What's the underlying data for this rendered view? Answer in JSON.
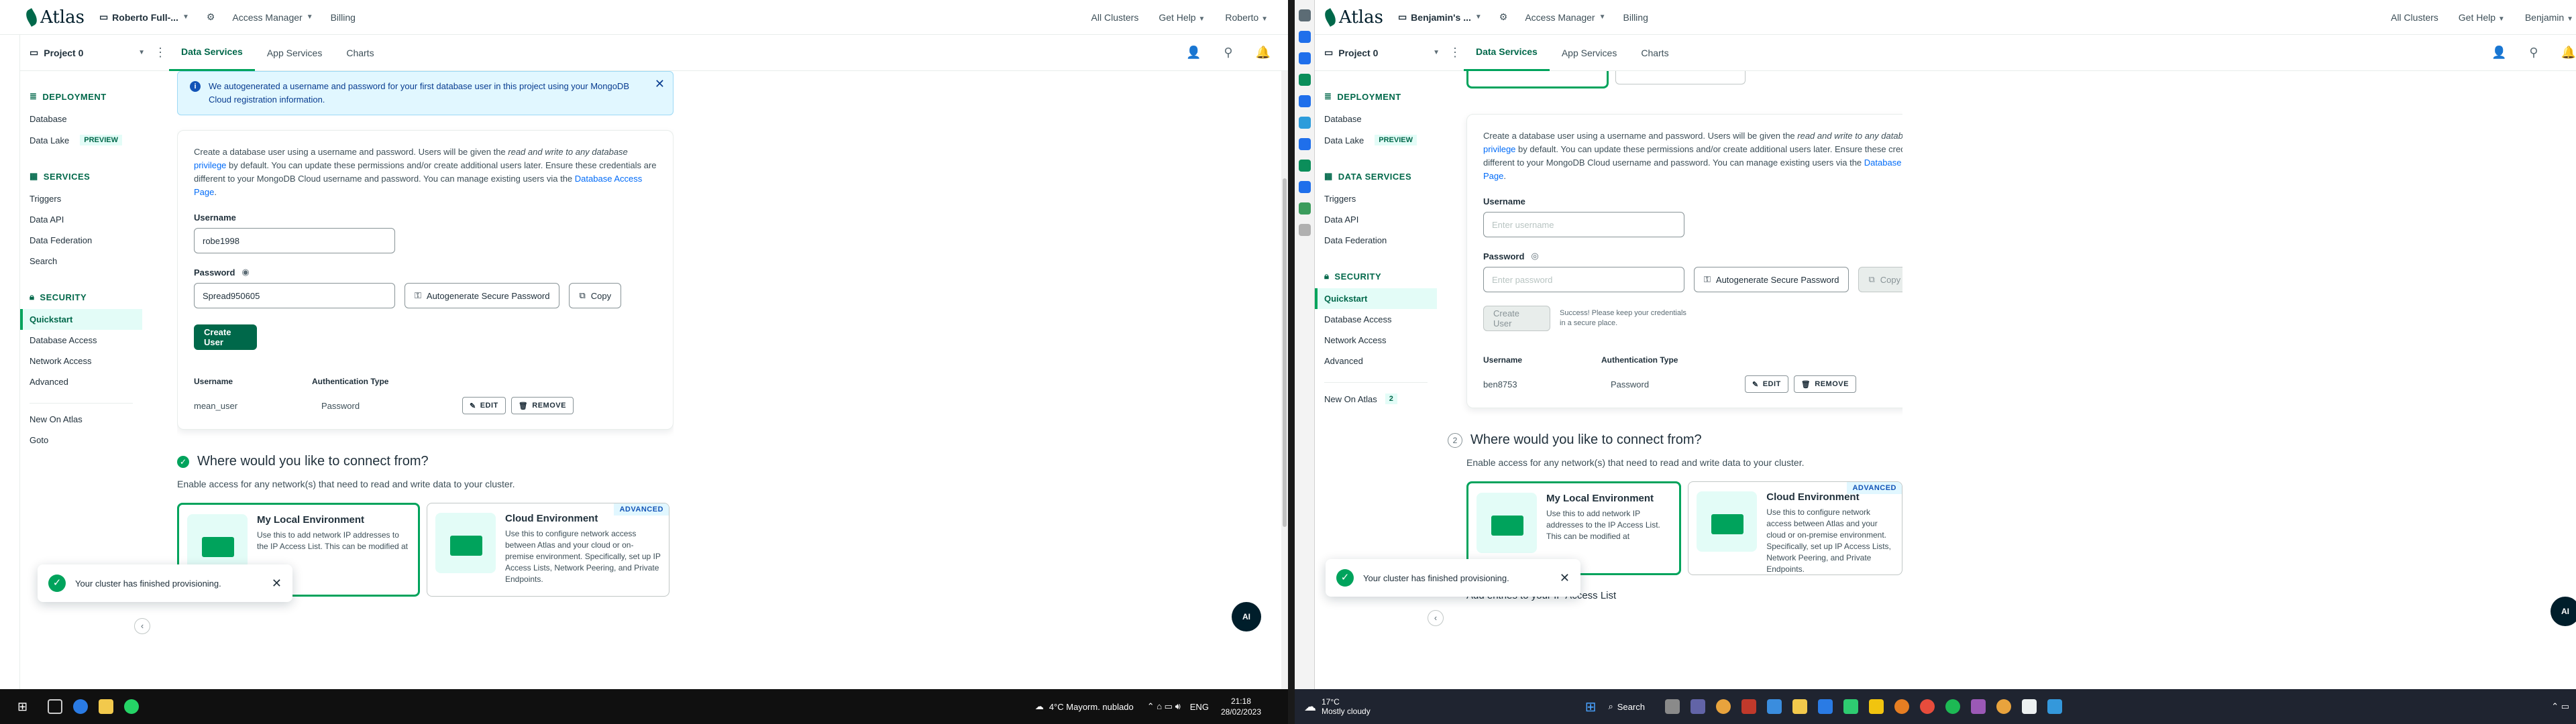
{
  "colors": {
    "accent": "#00684a",
    "accent_light": "#00a35c",
    "info_bg": "#e1f7ff",
    "link": "#016bf8"
  },
  "left": {
    "topbar": {
      "org": "Roberto Full-...",
      "access_manager": "Access Manager",
      "billing": "Billing",
      "all_clusters": "All Clusters",
      "get_help": "Get Help",
      "user": "Roberto"
    },
    "project": "Project 0",
    "tabs": [
      "Data Services",
      "App Services",
      "Charts"
    ],
    "sidebar": {
      "deployment": "DEPLOYMENT",
      "database": "Database",
      "data_lake": "Data Lake",
      "preview": "PREVIEW",
      "services": "SERVICES",
      "triggers": "Triggers",
      "data_api": "Data API",
      "data_federation": "Data Federation",
      "search": "Search",
      "security": "SECURITY",
      "quickstart": "Quickstart",
      "database_access": "Database Access",
      "network_access": "Network Access",
      "advanced": "Advanced",
      "new_on_atlas": "New On Atlas",
      "goto": "Goto"
    },
    "banner": "We autogenerated a username and password for your first database user in this project using your MongoDB Cloud registration information.",
    "desc_parts": {
      "a": "Create a database user using a username and password. Users will be given the ",
      "b": "read and write to any database",
      "c": " privilege",
      "d": " by default. You can update these permissions and/or create additional users later. Ensure these credentials are different to your MongoDB Cloud username and password. You can manage existing users via the ",
      "e": "Database Access Page",
      "f": "."
    },
    "username_label": "Username",
    "username_value": "robe1998",
    "password_label": "Password",
    "password_value": "Spread950605",
    "autogen_button": "Autogenerate Secure Password",
    "copy_button": "Copy",
    "create_user_button": "Create User",
    "table": {
      "col_user": "Username",
      "col_auth": "Authentication Type",
      "user": "mean_user",
      "auth": "Password",
      "edit": "EDIT",
      "remove": "REMOVE"
    },
    "connect_title": "Where would you like to connect from?",
    "connect_sub": "Enable access for any network(s) that need to read and write data to your cluster.",
    "local_env": {
      "title": "My Local Environment",
      "text": "Use this to add network IP addresses to the IP Access List. This can be modified at"
    },
    "cloud_env": {
      "title": "Cloud Environment",
      "badge": "ADVANCED",
      "text": "Use this to configure network access between Atlas and your cloud or on-premise environment. Specifically, set up IP Access Lists, Network Peering, and Private Endpoints."
    },
    "toast": "Your cluster has finished provisioning.",
    "fab": "AI",
    "taskbar": {
      "weather": "4°C  Mayorm. nublado",
      "lang": "ENG",
      "time": "21:18",
      "date": "28/02/2023"
    }
  },
  "right": {
    "topbar": {
      "org": "Benjamin's ...",
      "access_manager": "Access Manager",
      "billing": "Billing",
      "all_clusters": "All Clusters",
      "get_help": "Get Help",
      "user": "Benjamin"
    },
    "project": "Project 0",
    "tabs": [
      "Data Services",
      "App Services",
      "Charts"
    ],
    "sidebar": {
      "deployment": "DEPLOYMENT",
      "database": "Database",
      "data_lake": "Data Lake",
      "preview": "PREVIEW",
      "services": "DATA SERVICES",
      "triggers": "Triggers",
      "data_api": "Data API",
      "data_federation": "Data Federation",
      "security": "SECURITY",
      "quickstart": "Quickstart",
      "database_access": "Database Access",
      "network_access": "Network Access",
      "advanced": "Advanced",
      "new_on_atlas": "New On Atlas",
      "new_count": "2"
    },
    "desc_parts": {
      "a": "Create a database user using a username and password. Users will be given the ",
      "b": "read and write to any database",
      "c": " privilege",
      "d": " by default. You can update these permissions and/or create additional users later. Ensure these credentials are different to your MongoDB Cloud username and password. You can manage existing users via the ",
      "e": "Database Access Page",
      "f": "."
    },
    "username_label": "Username",
    "username_placeholder": "Enter username",
    "password_label": "Password",
    "password_placeholder": "Enter password",
    "autogen_button": "Autogenerate Secure Password",
    "copy_button": "Copy",
    "create_user_button": "Create User",
    "help_text": "Success! Please keep your credentials in a secure place.",
    "table": {
      "col_user": "Username",
      "col_auth": "Authentication Type",
      "user": "ben8753",
      "auth": "Password",
      "edit": "EDIT",
      "remove": "REMOVE"
    },
    "step_num": "2",
    "connect_title": "Where would you like to connect from?",
    "connect_sub": "Enable access for any network(s) that need to read and write data to your cluster.",
    "local_env": {
      "title": "My Local Environment",
      "text": "Use this to add network IP addresses to the IP Access List. This can be modified at"
    },
    "cloud_env": {
      "title": "Cloud Environment",
      "badge": "ADVANCED",
      "text": "Use this to configure network access between Atlas and your cloud or on-premise environment. Specifically, set up IP Access Lists, Network Peering, and Private Endpoints."
    },
    "toast": "Your cluster has finished provisioning.",
    "add_entries": "Add entries to your IP Access List",
    "fab": "AI",
    "taskbar": {
      "weather_temp": "17°C",
      "weather_desc": "Mostly cloudy",
      "search": "Search"
    }
  }
}
